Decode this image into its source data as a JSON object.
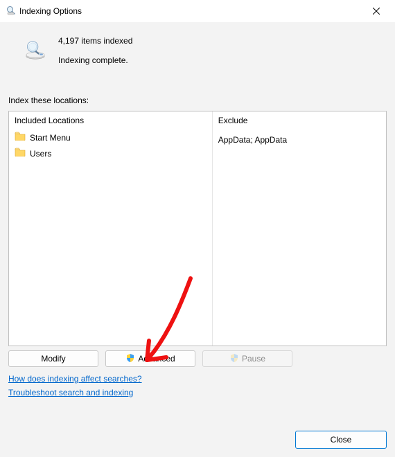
{
  "window": {
    "title": "Indexing Options"
  },
  "status": {
    "count_line": "4,197 items indexed",
    "state_line": "Indexing complete."
  },
  "section_label": "Index these locations:",
  "columns": {
    "included_header": "Included Locations",
    "excluded_header": "Exclude"
  },
  "locations": [
    {
      "name": "Start Menu",
      "exclude": ""
    },
    {
      "name": "Users",
      "exclude": "AppData; AppData"
    }
  ],
  "buttons": {
    "modify": "Modify",
    "advanced": "Advanced",
    "pause": "Pause",
    "close": "Close"
  },
  "links": {
    "how": "How does indexing affect searches?",
    "troubleshoot": "Troubleshoot search and indexing"
  },
  "icons": {
    "folder": "folder-icon",
    "shield": "shield-icon",
    "search_device": "indexing-search-icon"
  }
}
